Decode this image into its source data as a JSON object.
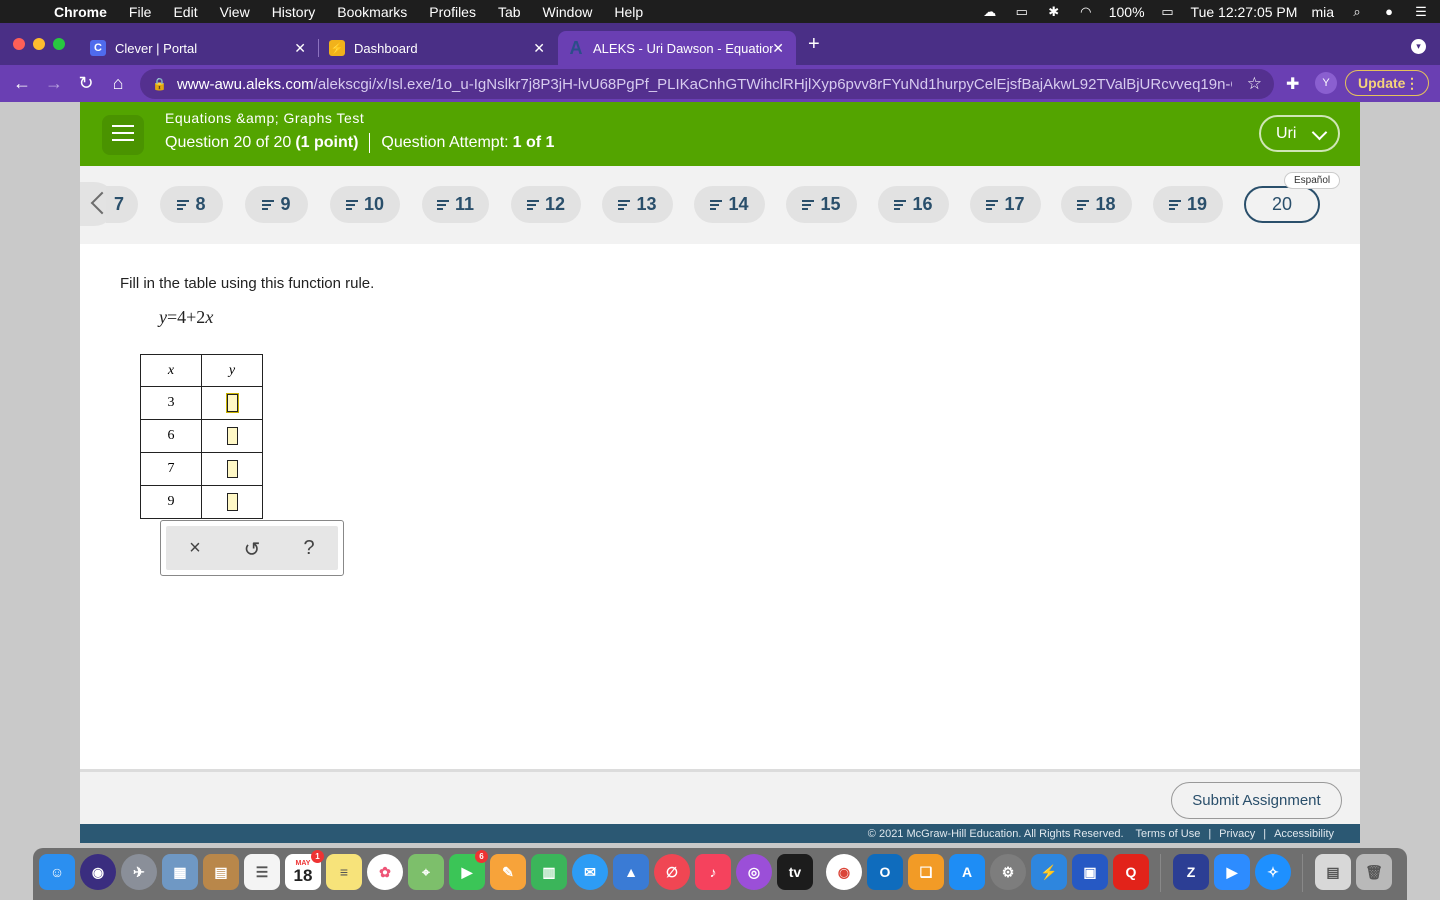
{
  "menubar": {
    "app": "Chrome",
    "items": [
      "File",
      "Edit",
      "View",
      "History",
      "Bookmarks",
      "Profiles",
      "Tab",
      "Window",
      "Help"
    ],
    "battery": "100%",
    "clock": "Tue 12:27:05 PM",
    "user": "mia"
  },
  "tabs": [
    {
      "title": "Clever | Portal",
      "favicon": "C",
      "color": "#4f6bed"
    },
    {
      "title": "Dashboard",
      "favicon": "⚡",
      "color": "#f1b21b"
    },
    {
      "title": "ALEKS - Uri Dawson - Equation",
      "favicon": "A",
      "color": "#2c4d8a"
    }
  ],
  "address": {
    "host": "www-awu.aleks.com",
    "path": "/alekscgi/x/Isl.exe/1o_u-IgNslkr7j8P3jH-lvU68PgPf_PLIKaCnhGTWihclRHjlXyp6pvv8rFYuNd1hurpyCelEjsfBajAkwL92TValBjURcvveq19n-C..."
  },
  "profile_initial": "Y",
  "update_label": "Update",
  "header": {
    "title": "Equations &amp; Graphs Test",
    "question_prefix": "Question 20 of 20",
    "points": "(1 point)",
    "attempt_label": "Question Attempt:",
    "attempt_value": "1 of 1",
    "user": "Uri"
  },
  "qnav": {
    "partial": "7",
    "questions": [
      "8",
      "9",
      "10",
      "11",
      "12",
      "13",
      "14",
      "15",
      "16",
      "17",
      "18",
      "19"
    ],
    "current": "20",
    "language": "Español"
  },
  "problem": {
    "prompt": "Fill in the table using this function rule.",
    "formula_lhs": "y",
    "formula_rhs_const": "=4+2",
    "formula_var": "x",
    "col_x": "x",
    "col_y": "y",
    "rows": [
      "3",
      "6",
      "7",
      "9"
    ]
  },
  "tools": {
    "clear": "×",
    "undo": "↺",
    "help": "?"
  },
  "footer": {
    "submit": "Submit Assignment",
    "copyright": "© 2021 McGraw-Hill Education. All Rights Reserved.",
    "links": [
      "Terms of Use",
      "Privacy",
      "Accessibility"
    ]
  },
  "dock": {
    "calendar_month": "MAY",
    "calendar_day": "18",
    "calendar_badge": "1",
    "facetime_badge": "6",
    "apps": [
      "finder-icon",
      "siri-icon",
      "launchpad-icon",
      "preview-icon",
      "contacts-icon",
      "reminders-icon",
      "calendar-icon",
      "notes-icon",
      "photos-icon",
      "maps-icon",
      "facetime-icon",
      "pages-icon",
      "numbers-icon",
      "messages-icon",
      "keynote-icon",
      "news-icon",
      "music-icon",
      "podcasts-icon",
      "appletv-icon",
      "chrome-icon",
      "outlook-icon",
      "books-icon",
      "appstore-icon",
      "settings-icon",
      "network-icon",
      "presenter-icon",
      "quizlet-icon",
      "zotero-icon",
      "zoom-icon",
      "safari-icon",
      "documents-icon",
      "trash-icon"
    ],
    "tv_label": "tv",
    "q_label": "Q"
  }
}
